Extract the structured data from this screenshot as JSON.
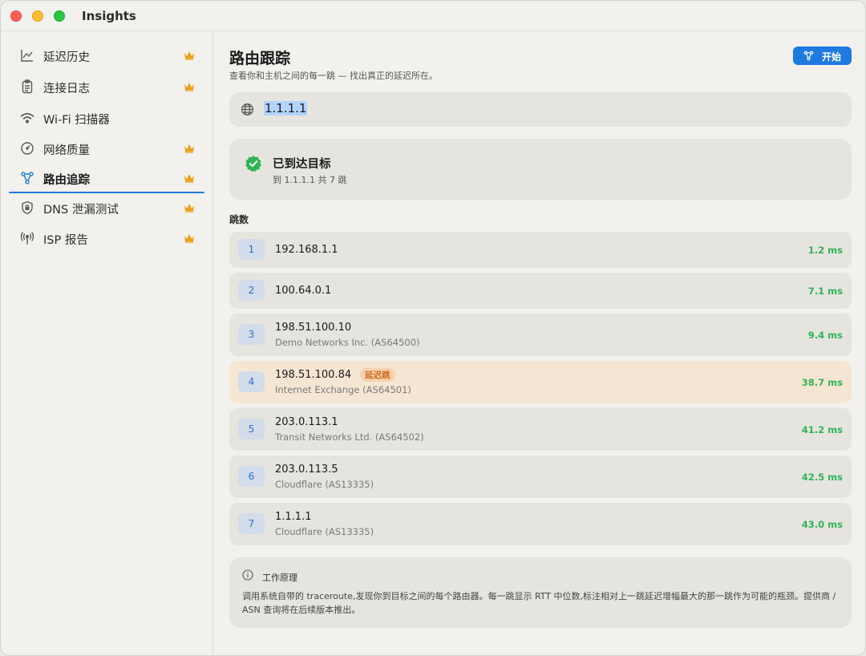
{
  "window": {
    "title": "Insights"
  },
  "sidebar": {
    "items": [
      {
        "label": "延迟历史",
        "icon": "chart-line-icon",
        "premium": true
      },
      {
        "label": "连接日志",
        "icon": "clipboard-icon",
        "premium": true
      },
      {
        "label": "Wi-Fi 扫描器",
        "icon": "wifi-icon",
        "premium": false
      },
      {
        "label": "网络质量",
        "icon": "gauge-icon",
        "premium": true
      },
      {
        "label": "路由追踪",
        "icon": "route-icon",
        "premium": true,
        "active": true
      },
      {
        "label": "DNS 泄漏测试",
        "icon": "lock-shield-icon",
        "premium": true
      },
      {
        "label": "ISP 报告",
        "icon": "antenna-icon",
        "premium": true
      }
    ]
  },
  "main": {
    "title": "路由跟踪",
    "subtitle": "查看你和主机之间的每一跳 — 找出真正的延迟所在。",
    "start_button": "开始",
    "target": "1.1.1.1",
    "status": {
      "title": "已到达目标",
      "subtitle": "到 1.1.1.1 共 7 跳"
    },
    "hops_label": "跳数",
    "hops": [
      {
        "num": "1",
        "ip": "192.168.1.1",
        "asn": "",
        "rtt": "1.2 ms",
        "badge": ""
      },
      {
        "num": "2",
        "ip": "100.64.0.1",
        "asn": "",
        "rtt": "7.1 ms",
        "badge": ""
      },
      {
        "num": "3",
        "ip": "198.51.100.10",
        "asn": "Demo Networks Inc. (AS64500)",
        "rtt": "9.4 ms",
        "badge": ""
      },
      {
        "num": "4",
        "ip": "198.51.100.84",
        "asn": "Internet Exchange (AS64501)",
        "rtt": "38.7 ms",
        "badge": "延迟跳"
      },
      {
        "num": "5",
        "ip": "203.0.113.1",
        "asn": "Transit Networks Ltd. (AS64502)",
        "rtt": "41.2 ms",
        "badge": ""
      },
      {
        "num": "6",
        "ip": "203.0.113.5",
        "asn": "Cloudflare (AS13335)",
        "rtt": "42.5 ms",
        "badge": ""
      },
      {
        "num": "7",
        "ip": "1.1.1.1",
        "asn": "Cloudflare (AS13335)",
        "rtt": "43.0 ms",
        "badge": ""
      }
    ],
    "info": {
      "title": "工作原理",
      "body": "调用系统自带的 traceroute,发现你到目标之间的每个路由器。每一跳显示 RTT 中位数,标注相对上一跳延迟增幅最大的那一跳作为可能的瓶颈。提供商 / ASN 查询将在后续版本推出。"
    }
  },
  "colors": {
    "accent": "#1f7ae0",
    "rtt_green": "#2fb457",
    "badge_orange": "#d2671b",
    "highlight_row": "#f5e6d3",
    "crown_gold": "#e8a317"
  }
}
